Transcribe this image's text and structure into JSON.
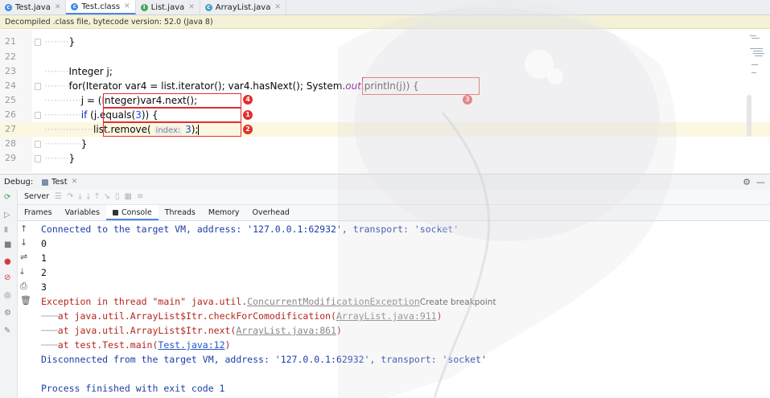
{
  "tabs": [
    {
      "label": "Test.java",
      "icon": "c",
      "active": false
    },
    {
      "label": "Test.class",
      "icon": "c",
      "active": true
    },
    {
      "label": "List.java",
      "icon": "i",
      "active": false
    },
    {
      "label": "ArrayList.java",
      "icon": "c",
      "active": false
    }
  ],
  "banner": "Decompiled .class file, bytecode version: 52.0 (Java 8)",
  "editor": {
    "line_numbers": [
      "21",
      "22",
      "23",
      "24",
      "25",
      "26",
      "27",
      "28",
      "29"
    ],
    "lines": {
      "l21": "}",
      "l23": "Integer j;",
      "l24_a": "for(Iterator var4 = list.iterator(); var4.hasNext(); ",
      "l24_b": "System.",
      "l24_c": "out",
      "l24_d": ".println(j)",
      "l24_e": ") {",
      "l25": "j = (Integer)var4.next();",
      "l26_a": "if",
      "l26_b": " (j.equals(",
      "l26_c": "3",
      "l26_d": ")) {",
      "l27_a": "list.remove( ",
      "l27_hint": "index:",
      "l27_c": " 3",
      "l27_d": ");",
      "l28": "}",
      "l29": "}"
    },
    "badges": [
      "4",
      "1",
      "2",
      "3"
    ]
  },
  "debug": {
    "label": "Debug:",
    "session": "Test",
    "server": "Server",
    "tabs": [
      "Frames",
      "Variables",
      "Console",
      "Threads",
      "Memory",
      "Overhead"
    ]
  },
  "console": {
    "connected": "Connected to the target VM, address: '127.0.0.1:62932', transport: 'socket'",
    "outputs": [
      "0",
      "1",
      "2",
      "3"
    ],
    "exception_prefix": "Exception in thread \"main\" java.util.",
    "exception_class": "ConcurrentModificationException",
    "create_breakpoint": "Create breakpoint",
    "stack": [
      {
        "prefix": "at java.util.ArrayList$Itr.checkForComodification(",
        "loc": "ArrayList.java:911",
        "suffix": ")",
        "style": "dim"
      },
      {
        "prefix": "at java.util.ArrayList$Itr.next(",
        "loc": "ArrayList.java:861",
        "suffix": ")",
        "style": "dim"
      },
      {
        "prefix": "at test.Test.main(",
        "loc": "Test.java:12",
        "suffix": ")",
        "style": "link"
      }
    ],
    "disconnected": "Disconnected from the target VM, address: '127.0.0.1:62932', transport: 'socket'",
    "finished": "Process finished with exit code 1"
  }
}
